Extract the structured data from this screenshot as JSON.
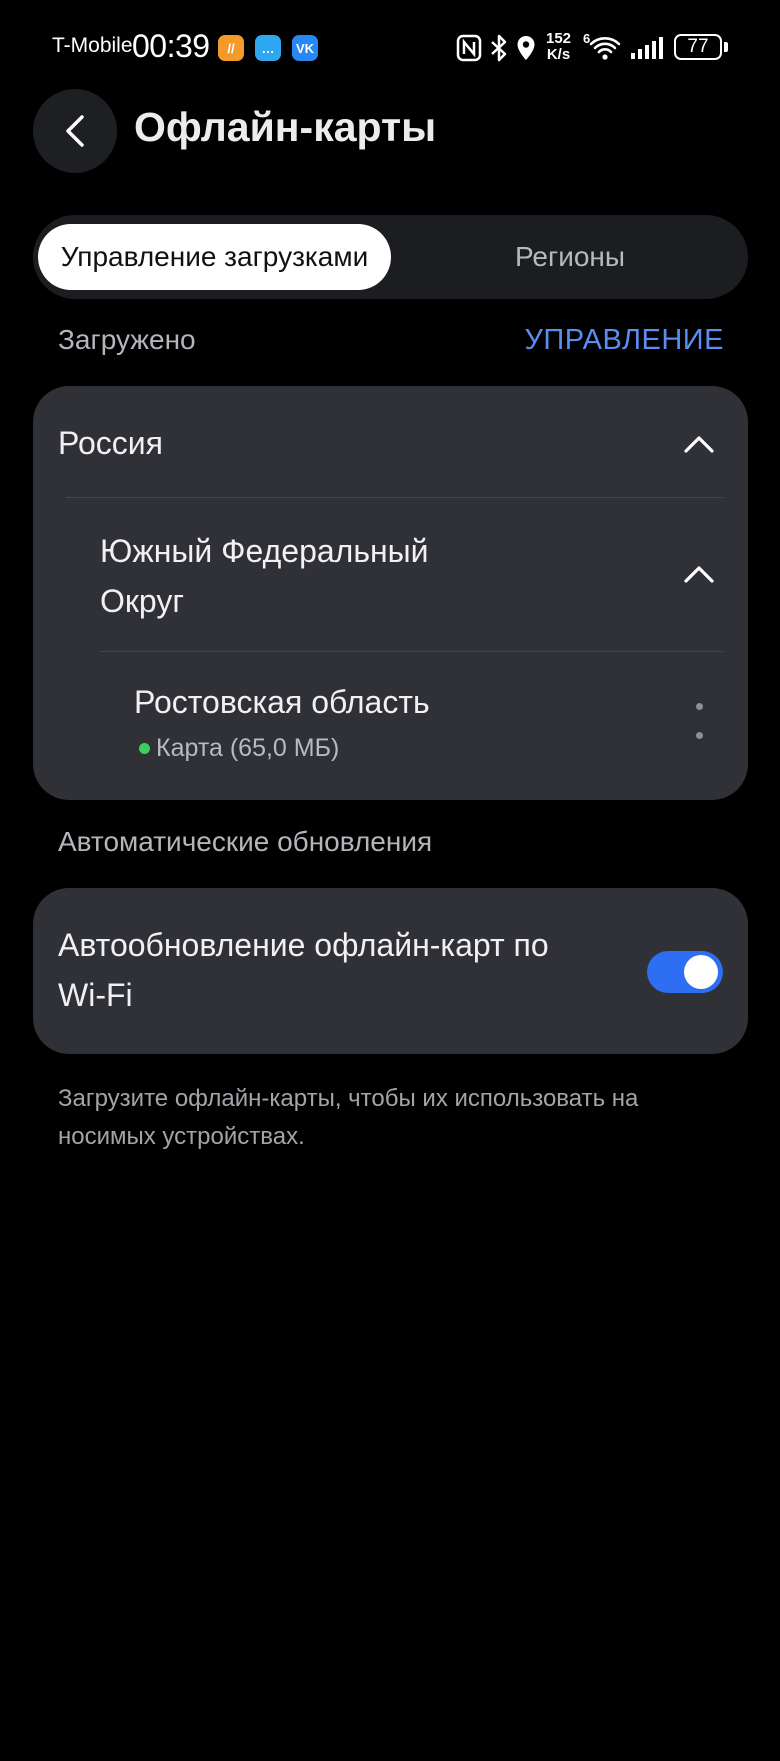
{
  "status_bar": {
    "carrier": "T-Mobile",
    "time": "00:39",
    "apps": [
      {
        "icon": "orange-app-icon",
        "color": "#f39a2b",
        "glyph": "//"
      },
      {
        "icon": "message-app-icon",
        "color": "#2ea6f0",
        "glyph": "…"
      },
      {
        "icon": "vk-icon",
        "color": "#2787f5",
        "glyph": "VK"
      }
    ],
    "net_speed_value": "152",
    "net_speed_unit": "K/s",
    "wifi_label": "6",
    "battery": "77"
  },
  "header": {
    "title": "Офлайн-карты",
    "back_icon": "chevron-left-icon"
  },
  "tabs": [
    {
      "label": "Управление загрузками",
      "active": true
    },
    {
      "label": "Регионы",
      "active": false
    }
  ],
  "downloaded": {
    "section_label": "Загружено",
    "manage_label": "УПРАВЛЕНИЕ",
    "country": "Россия",
    "district_line1": "Южный Федеральный",
    "district_line2": "Округ",
    "region": "Ростовская область",
    "region_meta": "Карта (65,0 МБ)",
    "status_color": "#3ccf5c"
  },
  "auto_updates": {
    "section_label": "Автоматические обновления",
    "setting_line1": "Автообновление офлайн-карт по",
    "setting_line2": "Wi-Fi",
    "enabled": true,
    "accent_color": "#2e6ef2"
  },
  "footnote": "Загрузите офлайн-карты, чтобы их использовать на носимых устройствах."
}
